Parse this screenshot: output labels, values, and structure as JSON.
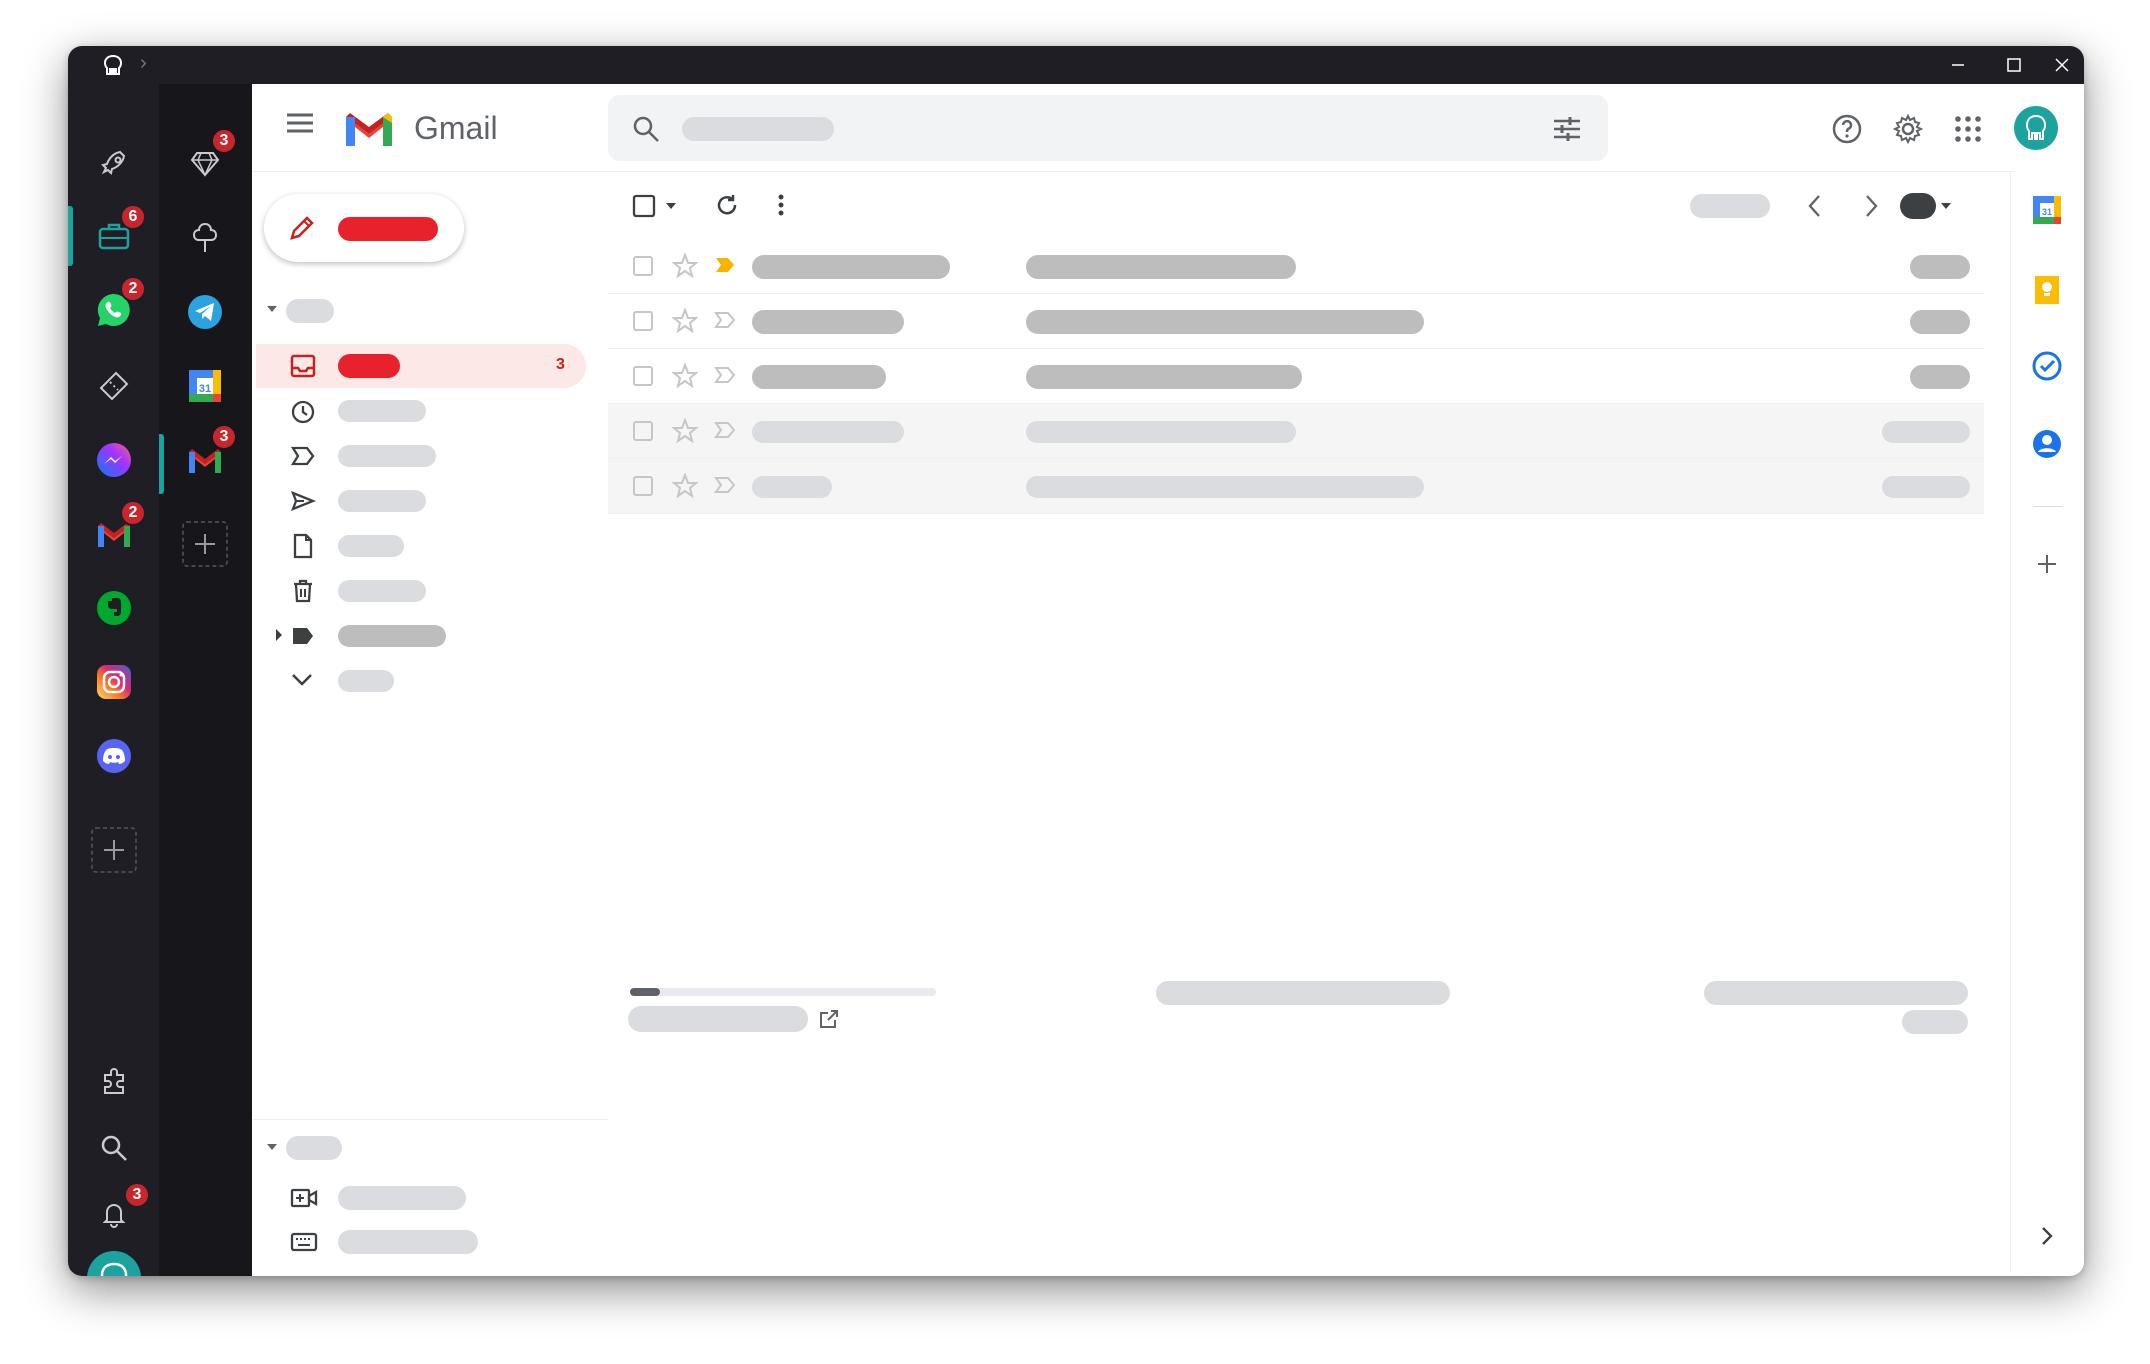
{
  "app": {
    "title": "Gmail"
  },
  "rail_main": {
    "items": [
      {
        "name": "rocket",
        "badge": ""
      },
      {
        "name": "briefcase",
        "badge": "6"
      },
      {
        "name": "whatsapp",
        "badge": "2"
      },
      {
        "name": "ticket",
        "badge": ""
      },
      {
        "name": "messenger",
        "badge": ""
      },
      {
        "name": "gmail",
        "badge": "2"
      },
      {
        "name": "evernote",
        "badge": ""
      },
      {
        "name": "instagram",
        "badge": ""
      },
      {
        "name": "discord",
        "badge": ""
      }
    ],
    "bottom": {
      "notifications_badge": "3"
    }
  },
  "rail_workspace": {
    "items": [
      {
        "name": "diamond",
        "badge": "3"
      },
      {
        "name": "tree",
        "badge": ""
      },
      {
        "name": "telegram",
        "badge": ""
      },
      {
        "name": "google-calendar",
        "badge": ""
      },
      {
        "name": "gmail",
        "badge": "3"
      }
    ]
  },
  "sidebar": {
    "inbox_count": "3"
  },
  "calendar_day": "31",
  "colors": {
    "accent": "#1ca3a0",
    "gmail_red": "#ea4335",
    "badge": "#c8262c",
    "important": "#f4b400"
  }
}
